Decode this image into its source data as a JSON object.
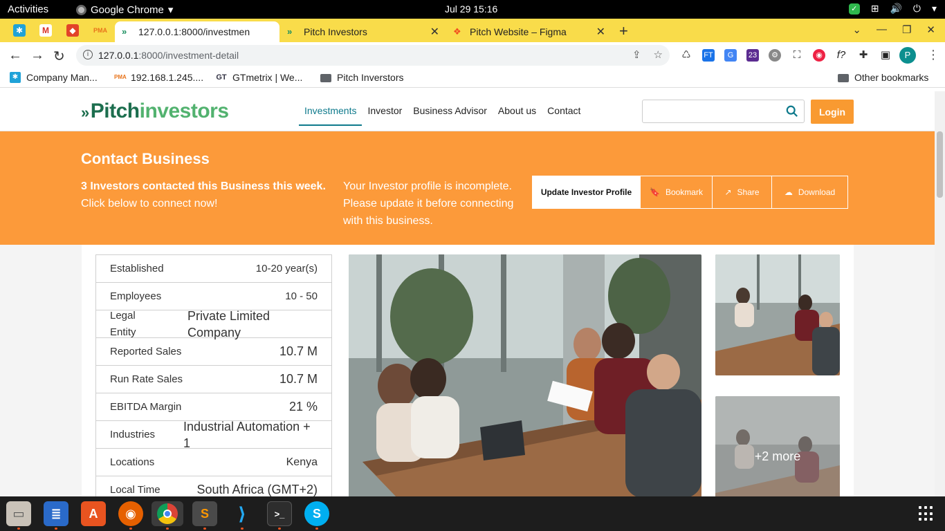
{
  "system": {
    "activities": "Activities",
    "app_name": "Google Chrome",
    "clock": "Jul 29  15:16"
  },
  "tabs": [
    {
      "label": "127.0.0.1:8000/investmen",
      "active": true
    },
    {
      "label": "Pitch Investors",
      "active": false
    },
    {
      "label": "Pitch Website – Figma",
      "active": false
    }
  ],
  "address": {
    "host": "127.0.0.1",
    "path": ":8000/investment-detail"
  },
  "bookmarks": [
    {
      "label": "Company Man...",
      "icon": "app-icon"
    },
    {
      "label": "192.168.1.245....",
      "icon": "pma-icon"
    },
    {
      "label": "GTmetrix | We...",
      "icon": "gtmetrix-icon"
    },
    {
      "label": "Pitch Inverstors",
      "icon": "folder-icon"
    }
  ],
  "other_bookmarks": "Other bookmarks",
  "profile_initial": "P",
  "site": {
    "logo_part1": "Pitch",
    "logo_part2": "investors",
    "nav": [
      "Investments",
      "Investor",
      "Business Advisor",
      "About us",
      "Contact"
    ],
    "search_placeholder": "",
    "login": "Login"
  },
  "banner": {
    "title": "Contact Business",
    "left_bold": "3 Investors contacted this Business this week.",
    "left_text": "Click below to connect now!",
    "mid_text": "Your Investor profile is incomplete. Please update it before connecting with this business.",
    "btn_update": "Update Investor Profile",
    "btn_bookmark": "Bookmark",
    "btn_share": "Share",
    "btn_download": "Download"
  },
  "facts": [
    {
      "label": "Established",
      "value": "10-20 year(s)"
    },
    {
      "label": "Employees",
      "value": "10 - 50"
    },
    {
      "label": "Legal Entity",
      "value": "Private Limited Company"
    },
    {
      "label": "Reported Sales",
      "value": "10.7 M"
    },
    {
      "label": "Run Rate Sales",
      "value": "10.7 M"
    },
    {
      "label": "EBITDA Margin",
      "value": "21 %"
    },
    {
      "label": "Industries",
      "value": "Industrial Automation + 1"
    },
    {
      "label": "Locations",
      "value": "Kenya"
    },
    {
      "label": "Local Time",
      "value": "South Africa (GMT+2)"
    }
  ],
  "gallery": {
    "more_label": "+2 more"
  },
  "colors": {
    "brand_orange": "#fc9a3a",
    "brand_green_dark": "#1c6e4e",
    "brand_green_light": "#52b26f",
    "nav_active": "#0e7a8c",
    "tab_strip": "#f9dc4a"
  }
}
